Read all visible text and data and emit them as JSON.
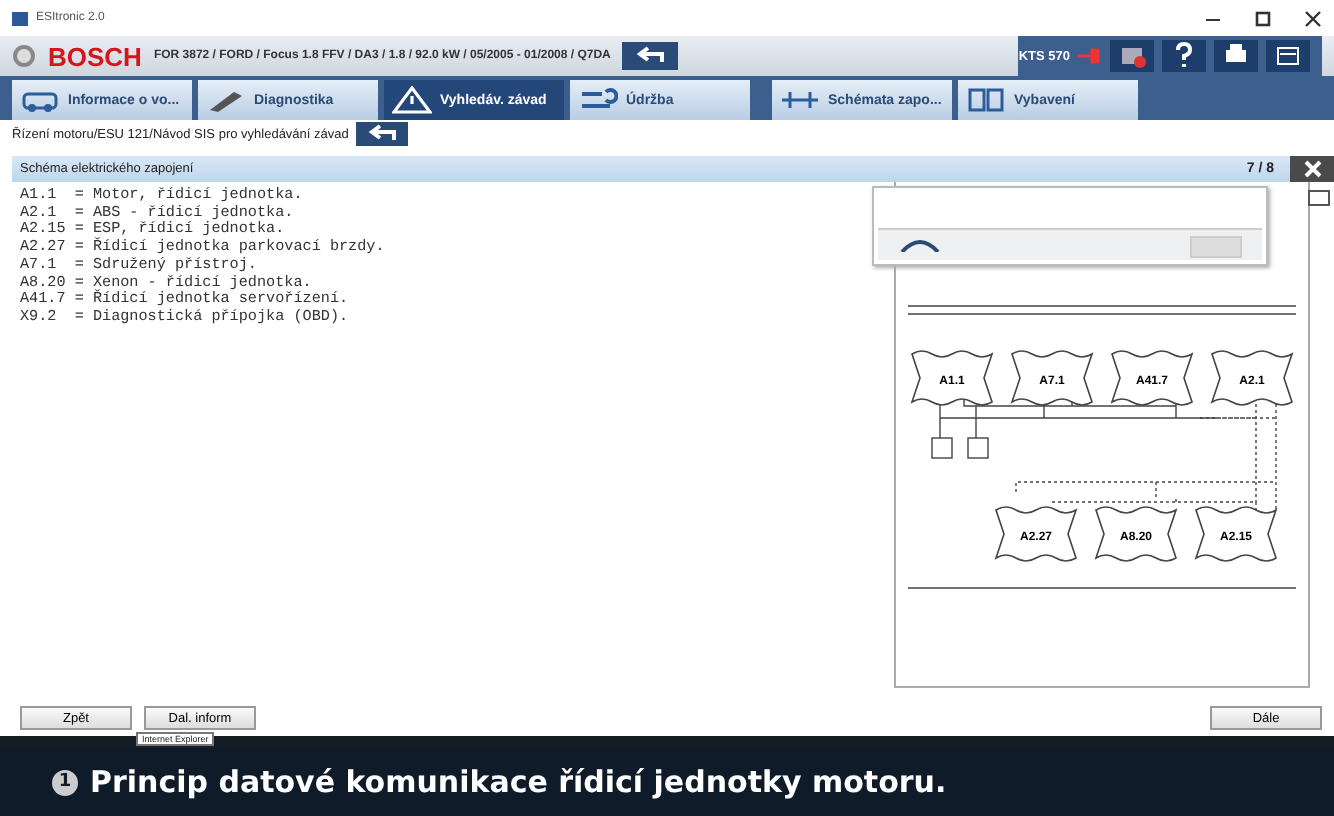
{
  "window": {
    "title": "ESItronic 2.0"
  },
  "header": {
    "brand": "BOSCH",
    "vehicle": "FOR 3872 / FORD / Focus 1.8 FFV / DA3 / 1.8 / 92.0 kW / 05/2005 - 01/2008 / Q7DA",
    "device": "KTS 570"
  },
  "tabs": [
    {
      "label": "Informace o vo...",
      "selected": false
    },
    {
      "label": "Diagnostika",
      "selected": false
    },
    {
      "label": "Vyhledáv. závad",
      "selected": true
    },
    {
      "label": "Údržba",
      "selected": false
    },
    {
      "label": "Schémata zapo...",
      "selected": false
    },
    {
      "label": "Vybavení",
      "selected": false
    }
  ],
  "breadcrumb": "Řízení motoru/ESU 121/Návod SIS pro vyhledávání závad",
  "panel": {
    "title": "Schéma elektrického zapojení",
    "page": "7 / 8",
    "legend": [
      "A1.1  = Motor, řídicí jednotka.",
      "A2.1  = ABS - řídicí jednotka.",
      "A2.15 = ESP, řídicí jednotka.",
      "A2.27 = Řídicí jednotka parkovací brzdy.",
      "A7.1  = Sdružený přístroj.",
      "A8.20 = Xenon - řídicí jednotka.",
      "A41.7 = Řídicí jednotka servořízení.",
      "X9.2  = Diagnostická přípojka (OBD)."
    ],
    "modules_top": [
      "A1.1",
      "A7.1",
      "A41.7",
      "A2.1"
    ],
    "modules_bottom": [
      "A2.27",
      "A8.20",
      "A2.15"
    ]
  },
  "buttons": {
    "back": "Zpět",
    "more": "Dal. inform",
    "next": "Dále"
  },
  "tooltip": "Internet Explorer",
  "caption": {
    "number": "1",
    "text": "Princip datové komunikace řídicí jednotky motoru."
  }
}
